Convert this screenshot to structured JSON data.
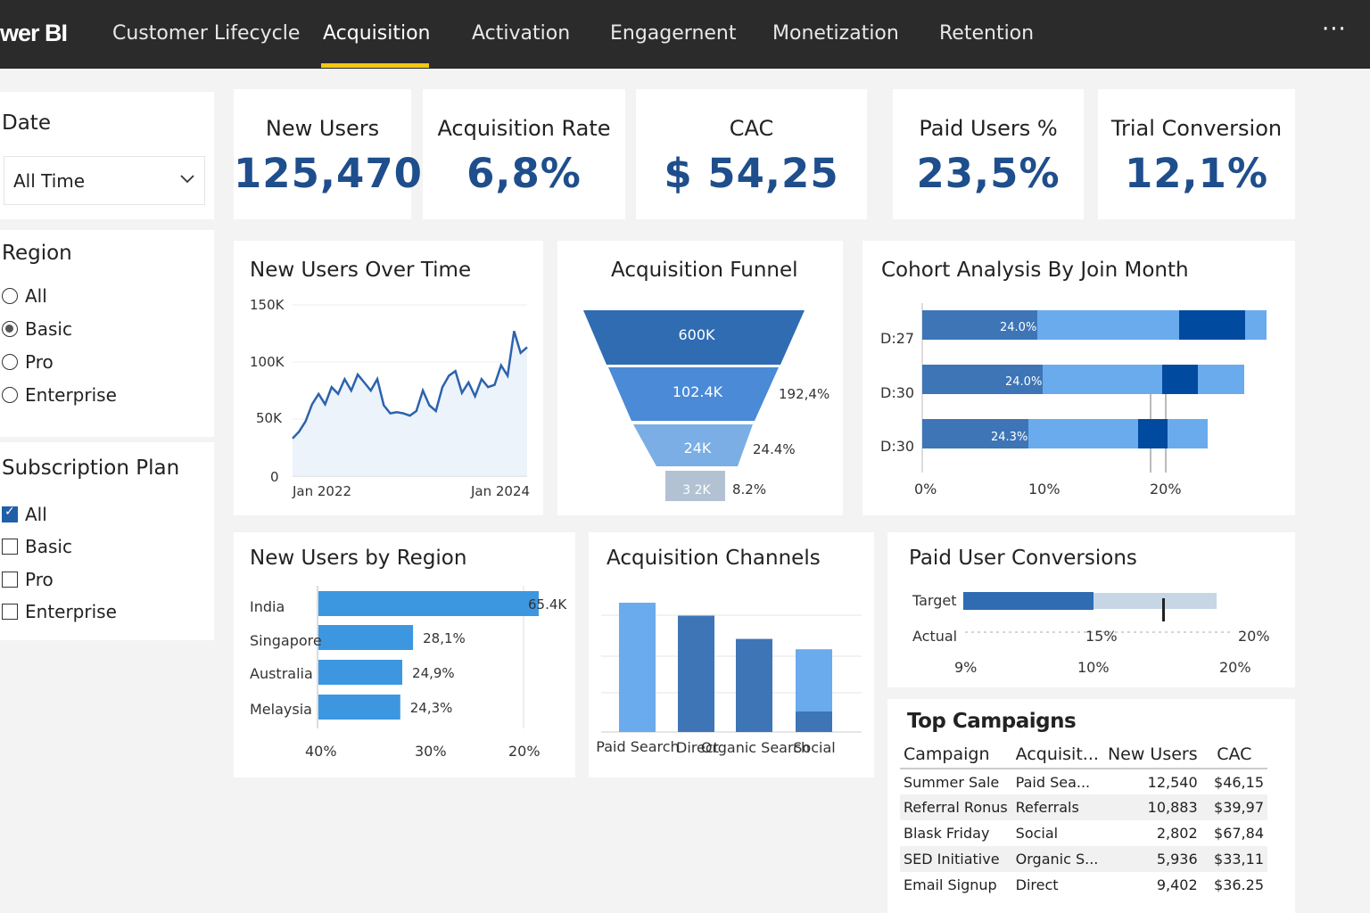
{
  "app": {
    "brand": "wer BI"
  },
  "nav": {
    "tabs": [
      {
        "label": "Customer Lifecycle"
      },
      {
        "label": "Acquisition"
      },
      {
        "label": "Activation"
      },
      {
        "label": "Engagernent"
      },
      {
        "label": "Monetization"
      },
      {
        "label": "Retention"
      }
    ],
    "active_tab": "Acquisition",
    "more": "···"
  },
  "filters": {
    "date": {
      "title": "Date",
      "value": "All Time"
    },
    "region": {
      "title": "Region",
      "options": [
        {
          "label": "All",
          "selected": false
        },
        {
          "label": "Basic",
          "selected": true
        },
        {
          "label": "Pro",
          "selected": false
        },
        {
          "label": "Enterprise",
          "selected": false
        }
      ]
    },
    "plan": {
      "title": "Subscription Plan",
      "options": [
        {
          "label": "All",
          "checked": true
        },
        {
          "label": "Basic",
          "checked": false
        },
        {
          "label": "Pro",
          "checked": false
        },
        {
          "label": "Enterprise",
          "checked": false
        }
      ]
    }
  },
  "kpis": [
    {
      "label": "New Users",
      "value": "125,470"
    },
    {
      "label": "Acquisition Rate",
      "value": "6,8%"
    },
    {
      "label": "CAC",
      "value": "$ 54,25"
    },
    {
      "label": "Paid Users %",
      "value": "23,5%"
    },
    {
      "label": "Trial Conversion",
      "value": "12,1%"
    }
  ],
  "colors": {
    "accent": "#f2c811",
    "kpi": "#1e4e8c",
    "dark_blue": "#004a9f",
    "mid_blue": "#3d75b7",
    "light_blue": "#6aabed"
  },
  "chart_data": [
    {
      "type": "line",
      "title": "New Users Over Time",
      "y_ticks": [
        "150K",
        "100K",
        "50K",
        "0"
      ],
      "ylim": [
        0,
        150000
      ],
      "x_labels": [
        "Jan 2022",
        "Jan 2024"
      ],
      "values": [
        33000,
        39000,
        48000,
        63000,
        72000,
        63000,
        78000,
        72000,
        85000,
        75000,
        89000,
        82000,
        75000,
        85000,
        62000,
        55000,
        56000,
        55000,
        53000,
        57000,
        75000,
        62000,
        57000,
        78000,
        88000,
        92000,
        73000,
        82000,
        70000,
        85000,
        78000,
        80000,
        97000,
        88000,
        127000,
        108000,
        113000
      ]
    },
    {
      "type": "funnel",
      "title": "Acquisition Funnel",
      "stages": [
        {
          "value": "600K",
          "rate": ""
        },
        {
          "value": "102.4K",
          "rate": "192,4%"
        },
        {
          "value": "24K",
          "rate": "24.4%"
        },
        {
          "value": "3 2K",
          "rate": "8.2%"
        }
      ]
    },
    {
      "type": "bar",
      "title": "Cohort Analysis By Join Month",
      "categories": [
        "D:27",
        "D:30",
        "D:30"
      ],
      "segment_labels": [
        "24.0%",
        "24.0%",
        "24.3%"
      ],
      "x_ticks": [
        "0%",
        "10%",
        "20%"
      ],
      "xlim": [
        0,
        30
      ]
    },
    {
      "type": "bar",
      "title": "New Users by Region",
      "categories": [
        "India",
        "Singapore",
        "Australia",
        "Melaysia"
      ],
      "values": [
        65.4,
        28.1,
        24.9,
        24.3
      ],
      "data_labels": [
        "65.4K",
        "28,1%",
        "24,9%",
        "24,3%"
      ],
      "x_ticks": [
        "40%",
        "30%",
        "20%"
      ]
    },
    {
      "type": "bar",
      "title": "Acquisition Channels",
      "categories": [
        "Paid Search",
        "Direct",
        "Organic Search",
        "Social"
      ],
      "values": [
        100,
        90,
        72,
        64
      ]
    },
    {
      "type": "bar",
      "title": "Paid User Conversions",
      "rows": [
        "Target",
        "Actual"
      ],
      "actual_value": 15,
      "target_value": 20,
      "marker_value": 17,
      "inline_labels": [
        "15%",
        "20%"
      ],
      "x_ticks": [
        "9%",
        "10%",
        "20%"
      ]
    }
  ],
  "campaigns": {
    "title": "Top Campaigns",
    "columns": [
      "Campaign",
      "Acquisit...",
      "New Users",
      "CAC"
    ],
    "rows": [
      [
        "Summer Sale",
        "Paid Sea...",
        "12,540",
        "$46,15"
      ],
      [
        "Referral Ronus",
        "Referrals",
        "10,883",
        "$39,97"
      ],
      [
        "Blask Friday",
        "Social",
        "2,802",
        "$67,84"
      ],
      [
        "SED Initiative",
        "Organic S...",
        "5,936",
        "$33,11"
      ],
      [
        "Email Signup",
        "Direct",
        "9,402",
        "$36.25"
      ]
    ]
  }
}
